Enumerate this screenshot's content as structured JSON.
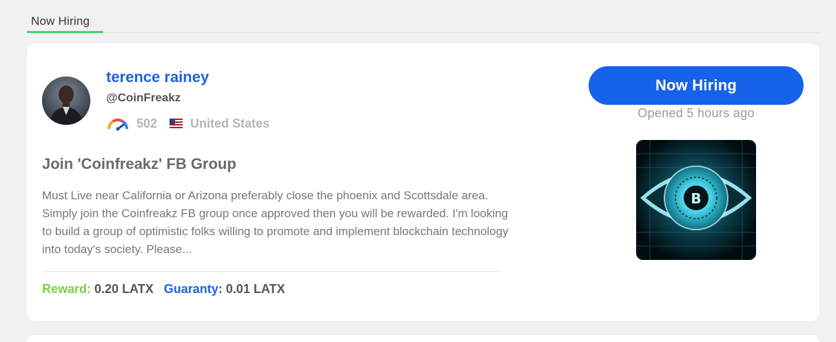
{
  "tabs": [
    {
      "label": "Now Hiring"
    }
  ],
  "job": {
    "user": {
      "name": "terence rainey",
      "handle": "@CoinFreakz",
      "score": "502",
      "country": "United States"
    },
    "title": "Join 'Coinfreakz' FB Group",
    "description": "Must Live near California or Arizona preferably close the phoenix and Scottsdale area. Simply join the Coinfreakz FB group once approved then you will be rewarded. I'm looking to build a group of optimistic folks willing to promote and implement blockchain technology into today's society. Please...",
    "reward_label": "Reward:",
    "reward_value": "0.20 LATX",
    "guaranty_label": "Guaranty:",
    "guaranty_value": "0.01 LATX",
    "cta_label": "Now Hiring",
    "opened": "Opened 5 hours ago"
  },
  "icons": {
    "rating": "gauge-icon",
    "country": "us-flag-icon"
  },
  "colors": {
    "accent_blue": "#1762ea",
    "link_blue": "#1e63e0",
    "reward_green": "#7ed03f",
    "tab_underline": "#46d369",
    "page_bg": "#f1f1f1"
  }
}
